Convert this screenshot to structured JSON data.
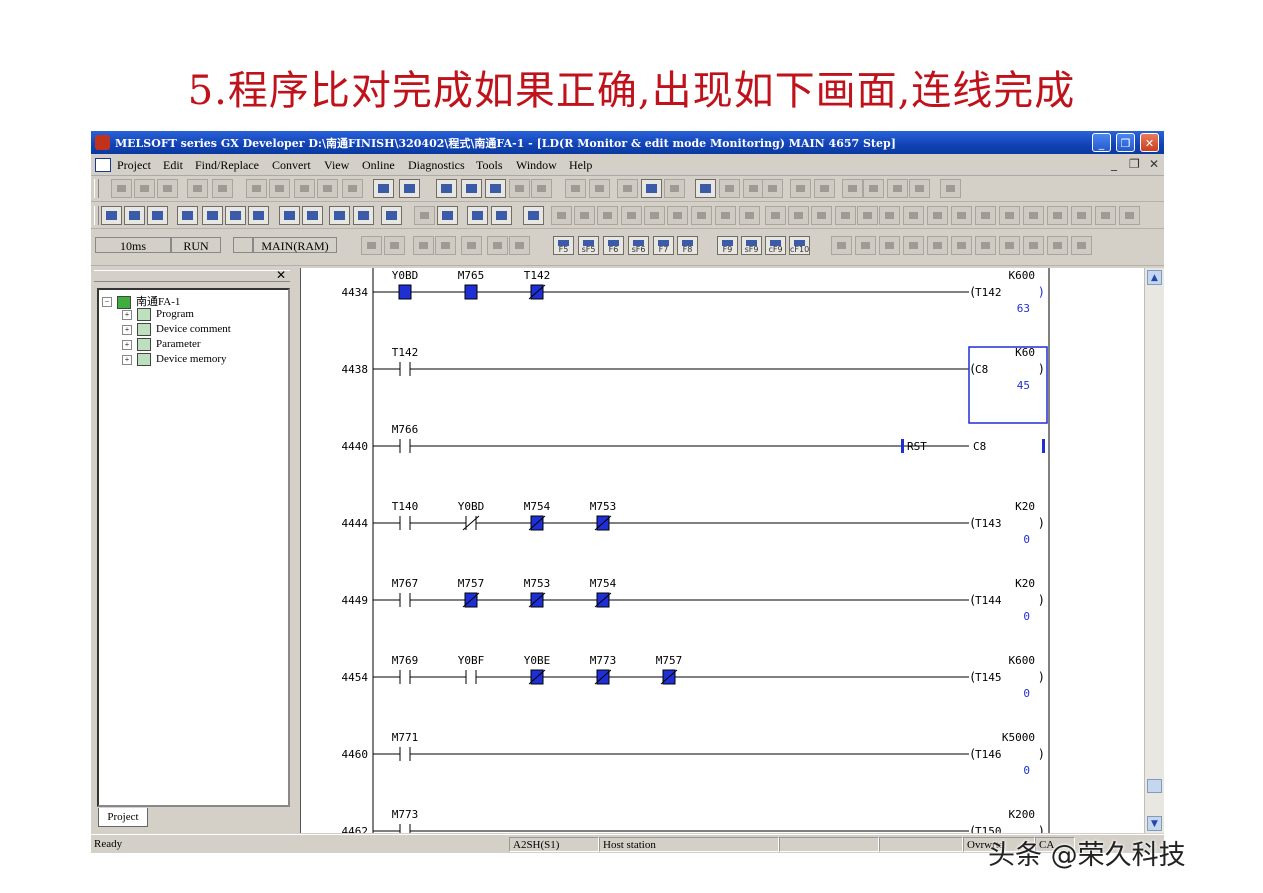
{
  "slide": {
    "title": "5.程序比对完成如果正确,出现如下画面,连线完成"
  },
  "window": {
    "title": "MELSOFT series GX Developer D:\\南通FINISH\\320402\\程式\\南通FA-1 - [LD(R Monitor & edit mode Monitoring)     MAIN     4657 Step]",
    "min_label": "_",
    "max_label": "❐",
    "close_label": "✕"
  },
  "menu": {
    "items": [
      "Project",
      "Edit",
      "Find/Replace",
      "Convert",
      "View",
      "Online",
      "Diagnostics",
      "Tools",
      "Window",
      "Help"
    ],
    "mdi_controls": [
      "_",
      "❐",
      "✕"
    ]
  },
  "toolbar3": {
    "scan_time": "10ms",
    "cpu_state": "RUN",
    "program_name": "MAIN(RAM)",
    "keys": [
      "F5",
      "sF5",
      "F6",
      "sF6",
      "F7",
      "F8",
      "F9",
      "sF9",
      "cF9",
      "cF10"
    ]
  },
  "project_tree": {
    "root": "南通FA-1",
    "items": [
      "Program",
      "Device comment",
      "Parameter",
      "Device memory"
    ],
    "tab": "Project",
    "close": "✕"
  },
  "ladder": {
    "rungs": [
      {
        "step": "4434",
        "contacts": [
          {
            "dev": "Y0BD",
            "type": "no",
            "state": "on"
          },
          {
            "dev": "M765",
            "type": "no",
            "state": "on"
          },
          {
            "dev": "T142",
            "type": "nc",
            "state": "on"
          }
        ],
        "coil": {
          "dev": "T142",
          "setting": "K600",
          "value": "63",
          "kind": "timer"
        }
      },
      {
        "step": "4438",
        "contacts": [
          {
            "dev": "T142",
            "type": "no",
            "state": "off"
          }
        ],
        "coil": {
          "dev": "C8",
          "setting": "K60",
          "value": "45",
          "kind": "counter"
        }
      },
      {
        "step": "4440",
        "contacts": [
          {
            "dev": "M766",
            "type": "no",
            "state": "off"
          }
        ],
        "coil": {
          "dev": "C8",
          "instr": "RST",
          "kind": "rst"
        }
      },
      {
        "step": "4444",
        "contacts": [
          {
            "dev": "T140",
            "type": "no",
            "state": "off"
          },
          {
            "dev": "Y0BD",
            "type": "nc",
            "state": "off"
          },
          {
            "dev": "M754",
            "type": "nc",
            "state": "on"
          },
          {
            "dev": "M753",
            "type": "nc",
            "state": "on"
          }
        ],
        "coil": {
          "dev": "T143",
          "setting": "K20",
          "value": "0",
          "kind": "timer"
        }
      },
      {
        "step": "4449",
        "contacts": [
          {
            "dev": "M767",
            "type": "no",
            "state": "off"
          },
          {
            "dev": "M757",
            "type": "nc",
            "state": "on"
          },
          {
            "dev": "M753",
            "type": "nc",
            "state": "on"
          },
          {
            "dev": "M754",
            "type": "nc",
            "state": "on"
          }
        ],
        "coil": {
          "dev": "T144",
          "setting": "K20",
          "value": "0",
          "kind": "timer"
        }
      },
      {
        "step": "4454",
        "contacts": [
          {
            "dev": "M769",
            "type": "no",
            "state": "off"
          },
          {
            "dev": "Y0BF",
            "type": "no",
            "state": "off"
          },
          {
            "dev": "Y0BE",
            "type": "nc",
            "state": "on"
          },
          {
            "dev": "M773",
            "type": "nc",
            "state": "on"
          },
          {
            "dev": "M757",
            "type": "nc",
            "state": "on"
          }
        ],
        "coil": {
          "dev": "T145",
          "setting": "K600",
          "value": "0",
          "kind": "timer"
        }
      },
      {
        "step": "4460",
        "contacts": [
          {
            "dev": "M771",
            "type": "no",
            "state": "off"
          }
        ],
        "coil": {
          "dev": "T146",
          "setting": "K5000",
          "value": "0",
          "kind": "timer"
        }
      },
      {
        "step": "4462",
        "contacts": [
          {
            "dev": "M773",
            "type": "no",
            "state": "off"
          }
        ],
        "coil": {
          "dev": "T150",
          "setting": "K200",
          "value": "",
          "kind": "timer"
        }
      }
    ]
  },
  "statusbar": {
    "ready": "Ready",
    "plc_type": "A2SH(S1)",
    "station": "Host station",
    "mode": "Ovrwrte",
    "extra": "CA"
  },
  "watermark": "头条 @荣久科技",
  "colors": {
    "slide_title": "#c0121a",
    "title_bar": "#1143b6",
    "contact_on": "#1f2fd6",
    "line": "#000000"
  }
}
